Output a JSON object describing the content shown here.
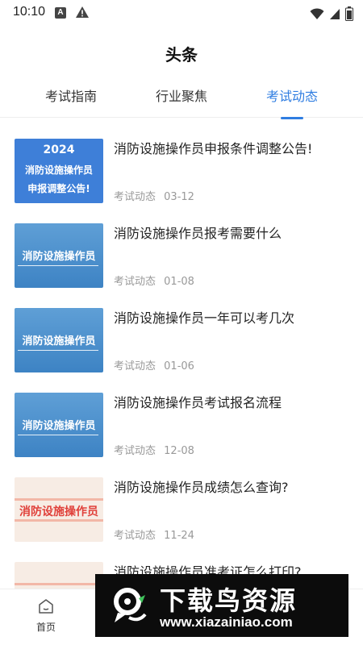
{
  "status_bar": {
    "time": "10:10",
    "left_icons": [
      "a-icon",
      "warning-icon"
    ],
    "right_icons": [
      "wifi-icon",
      "signal-icon",
      "battery-icon"
    ]
  },
  "header": {
    "title": "头条"
  },
  "tabs": [
    {
      "label": "考试指南",
      "active": false
    },
    {
      "label": "行业聚焦",
      "active": false
    },
    {
      "label": "考试动态",
      "active": true
    }
  ],
  "articles": [
    {
      "title": "消防设施操作员申报条件调整公告!",
      "category": "考试动态",
      "date": "03-12",
      "thumb": {
        "style": "blue-strong",
        "lines": [
          "2024",
          "消防设施操作员",
          "申报调整公告!"
        ]
      }
    },
    {
      "title": "消防设施操作员报考需要什么",
      "category": "考试动态",
      "date": "01-08",
      "thumb": {
        "style": "blue",
        "lines": [
          "消防设施操作员"
        ]
      }
    },
    {
      "title": "消防设施操作员一年可以考几次",
      "category": "考试动态",
      "date": "01-06",
      "thumb": {
        "style": "blue",
        "lines": [
          "消防设施操作员"
        ]
      }
    },
    {
      "title": "消防设施操作员考试报名流程",
      "category": "考试动态",
      "date": "12-08",
      "thumb": {
        "style": "blue",
        "lines": [
          "消防设施操作员"
        ]
      }
    },
    {
      "title": "消防设施操作员成绩怎么查询?",
      "category": "考试动态",
      "date": "11-24",
      "thumb": {
        "style": "peach",
        "lines": [
          "消防设施操作员"
        ]
      }
    },
    {
      "title": "消防设施操作员准考证怎么打印?",
      "category": "",
      "date": "",
      "thumb": {
        "style": "peach",
        "lines": []
      }
    }
  ],
  "bottom_nav": {
    "home_label": "首页"
  },
  "watermark": {
    "title": "下载鸟资源",
    "url": "www.xiazainiao.com"
  },
  "colors": {
    "accent": "#2f7de1",
    "meta": "#999999",
    "thumb_blue": "#4a8ccb",
    "thumb_red_text": "#e0403a"
  }
}
